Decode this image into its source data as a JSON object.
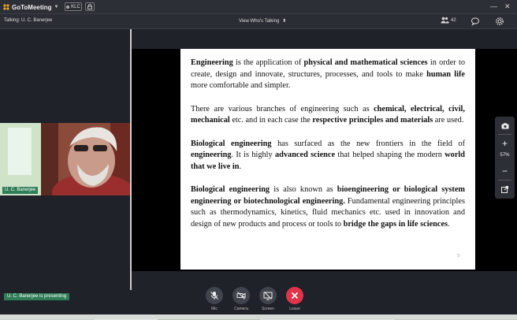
{
  "app": {
    "name": "GoToMeeting"
  },
  "topbar": {
    "badge_label": "KLC"
  },
  "talkbar": {
    "talking_text": "Talking: U. C. Banerjee",
    "view_label": "View Who's Talking",
    "attendee_count": "42"
  },
  "video": {
    "participant_name": "U. C. Banerjee"
  },
  "zoom": {
    "level": "57%"
  },
  "presenting_badge": "U. C. Banerjee is presenting",
  "controls": {
    "mic_label": "Mic",
    "camera_label": "Camera",
    "screen_label": "Screen",
    "leave_label": "Leave"
  },
  "document": {
    "page_number": "3",
    "p1": [
      {
        "t": "Engineering",
        "b": true
      },
      {
        "t": " is the application of ",
        "b": false
      },
      {
        "t": "physical and mathematical sciences",
        "b": true
      },
      {
        "t": " in order to create, design and innovate, structures, processes, and tools to make ",
        "b": false
      },
      {
        "t": "human life",
        "b": true
      },
      {
        "t": " more comfortable and simpler.",
        "b": false
      }
    ],
    "p2": [
      {
        "t": "There are various branches of engineering such as ",
        "b": false
      },
      {
        "t": "chemical, electrical, civil, mechanical",
        "b": true
      },
      {
        "t": " etc. and in each case the ",
        "b": false
      },
      {
        "t": "respective principles and materials",
        "b": true
      },
      {
        "t": " are used.",
        "b": false
      }
    ],
    "p3": [
      {
        "t": "Biological engineering",
        "b": true
      },
      {
        "t": " has surfaced as the new frontiers in the field of ",
        "b": false
      },
      {
        "t": "engineering",
        "b": true
      },
      {
        "t": ". It is highly ",
        "b": false
      },
      {
        "t": "advanced science",
        "b": true
      },
      {
        "t": " that helped shaping the modern ",
        "b": false
      },
      {
        "t": "world that we live in",
        "b": true
      },
      {
        "t": ".",
        "b": false
      }
    ],
    "p4": [
      {
        "t": "Biological engineering",
        "b": true
      },
      {
        "t": " is also known as ",
        "b": false
      },
      {
        "t": "bioengineering or biological system engineering or  biotechnological engineering.",
        "b": true
      },
      {
        "t": " Fundamental engineering principles such as thermodynamics, kinetics, fluid mechanics etc. used in innovation and design of new products and process or tools to ",
        "b": false
      },
      {
        "t": "bridge the gaps in life sciences",
        "b": true
      },
      {
        "t": ".",
        "b": false
      }
    ]
  }
}
